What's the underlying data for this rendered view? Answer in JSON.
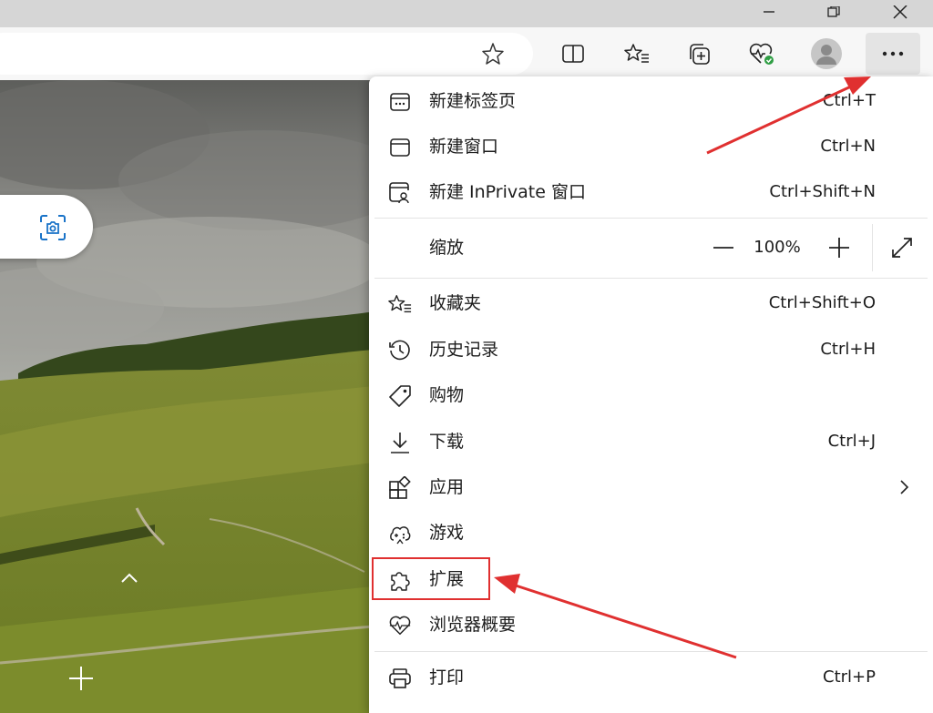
{
  "window": {
    "minimize_icon": "minimize-icon",
    "restore_icon": "restore-icon",
    "close_icon": "close-icon"
  },
  "toolbar": {
    "icons": [
      "favorite-star-icon",
      "split-screen-icon",
      "favorites-list-icon",
      "collections-icon",
      "browser-essentials-icon",
      "profile-avatar-icon",
      "more-icon"
    ]
  },
  "menu": {
    "new_tab": {
      "label": "新建标签页",
      "shortcut": "Ctrl+T"
    },
    "new_window": {
      "label": "新建窗口",
      "shortcut": "Ctrl+N"
    },
    "new_inprivate": {
      "label": "新建 InPrivate 窗口",
      "shortcut": "Ctrl+Shift+N"
    },
    "zoom": {
      "label": "缩放",
      "value": "100%"
    },
    "favorites": {
      "label": "收藏夹",
      "shortcut": "Ctrl+Shift+O"
    },
    "history": {
      "label": "历史记录",
      "shortcut": "Ctrl+H"
    },
    "shopping": {
      "label": "购物"
    },
    "downloads": {
      "label": "下载",
      "shortcut": "Ctrl+J"
    },
    "apps": {
      "label": "应用"
    },
    "games": {
      "label": "游戏"
    },
    "extensions": {
      "label": "扩展"
    },
    "essentials": {
      "label": "浏览器概要"
    },
    "print": {
      "label": "打印",
      "shortcut": "Ctrl+P"
    }
  },
  "colors": {
    "annotation": "#e03030",
    "menu_bg": "#ffffff",
    "toolbar_bg": "#f7f7f7"
  }
}
